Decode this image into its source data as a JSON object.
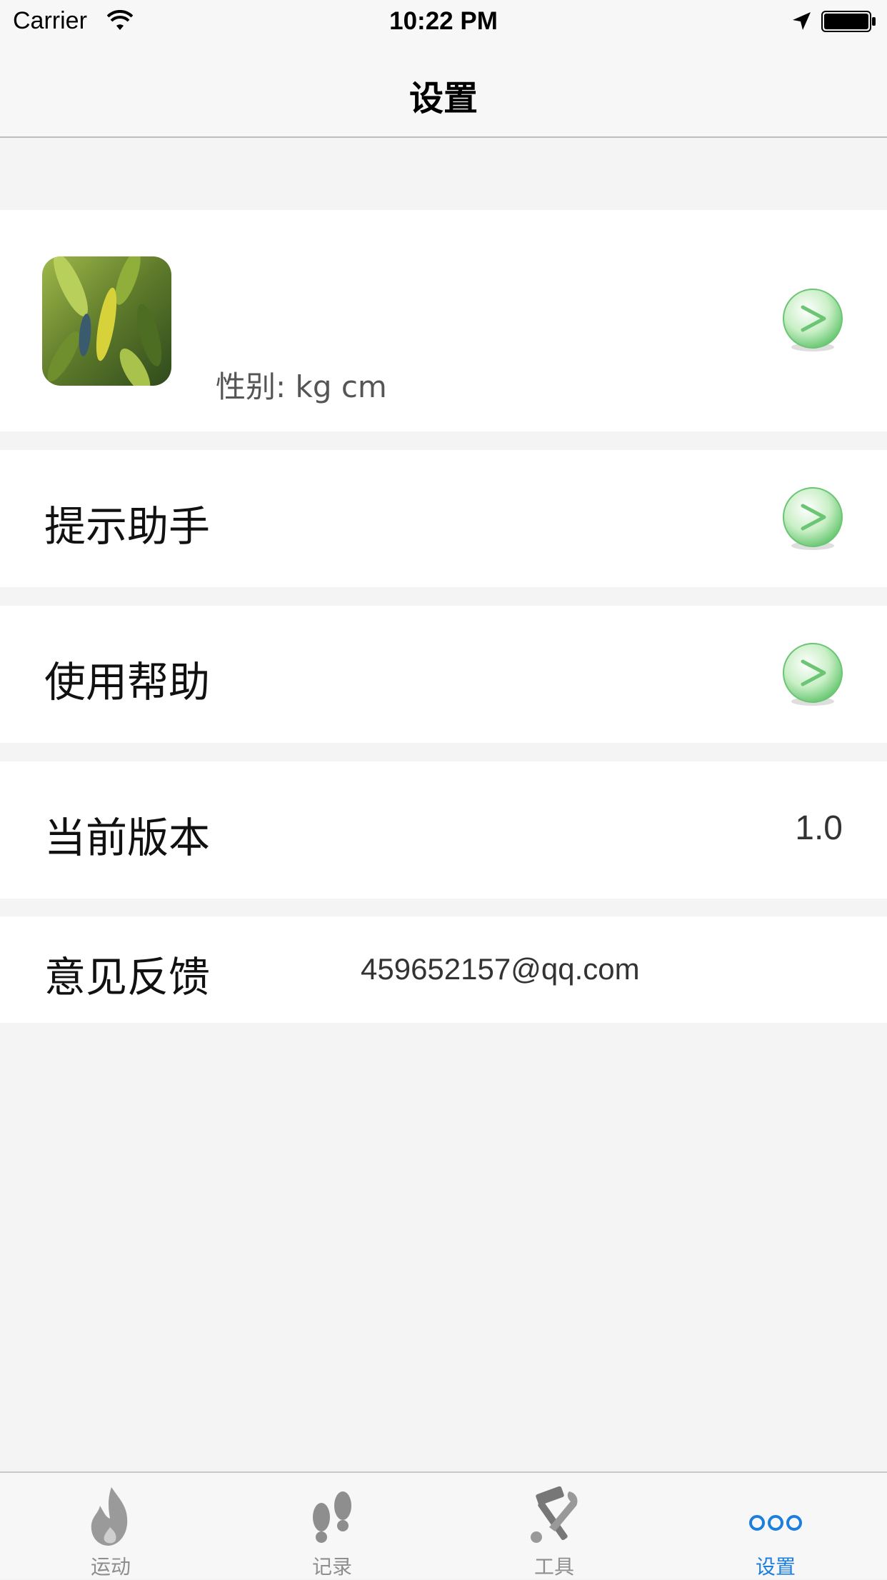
{
  "status_bar": {
    "carrier": "Carrier",
    "time": "10:22 PM"
  },
  "nav": {
    "title": "设置"
  },
  "profile": {
    "subtitle": "性别: kg cm"
  },
  "rows": {
    "assistant": {
      "label": "提示助手"
    },
    "help": {
      "label": "使用帮助"
    },
    "version": {
      "label": "当前版本",
      "value": "1.0"
    },
    "feedback": {
      "label": "意见反馈",
      "email": "459652157@qq.com"
    }
  },
  "tabs": [
    {
      "label": "运动",
      "icon": "flame-icon",
      "active": false
    },
    {
      "label": "记录",
      "icon": "footprints-icon",
      "active": false
    },
    {
      "label": "工具",
      "icon": "tools-icon",
      "active": false
    },
    {
      "label": "设置",
      "icon": "more-dots-icon",
      "active": true
    }
  ],
  "colors": {
    "accent": "#1b7fe0",
    "arrow_green": "#5fc46a",
    "background": "#f4f4f4"
  }
}
